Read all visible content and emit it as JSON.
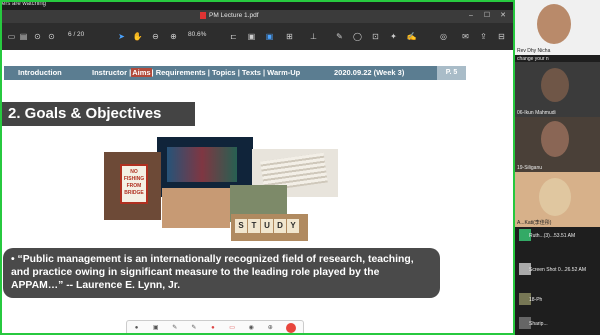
{
  "banner": {
    "text": "ers are watching"
  },
  "window": {
    "title": "PM Lecture 1.pdf"
  },
  "toolbar": {
    "page": "6",
    "page_total": "/ 20",
    "zoom": "80.6%"
  },
  "slide": {
    "nav": {
      "intro": "Introduction",
      "instructor": "Instructor | ",
      "aims": "Aims",
      "rest": " | Requirements | Topics | Texts | Warm-Up",
      "date": "2020.09.22  (Week 3)",
      "page_tag": "P. 5"
    },
    "heading": "2. Goals & Objectives",
    "nofish_sign": "NO FISHING FROM BRIDGE",
    "study_word": [
      "S",
      "T",
      "U",
      "D",
      "Y"
    ],
    "quote": "•  “Public management is an internationally recognized field of research, teaching, and practice owing in significant measure to the leading role played by the APPAM…” -- Laurence E. Lynn, Jr."
  },
  "zoom_controls": {
    "items": [
      {
        "label": "",
        "icon": "mic-icon"
      },
      {
        "label": "",
        "icon": "video-icon"
      },
      {
        "label": "",
        "icon": "security-icon"
      },
      {
        "label": "",
        "icon": "participants-icon"
      },
      {
        "label": "",
        "icon": "chat-icon"
      },
      {
        "label": "",
        "icon": "share-icon"
      },
      {
        "label": "",
        "icon": "record-icon"
      },
      {
        "label": "",
        "icon": "reactions-icon"
      }
    ]
  },
  "participants": {
    "tile1": {
      "name": "Rev Dhy Nicha",
      "overlay": "change your n"
    },
    "tile2": {
      "name": "06-Ikun Mahmudi"
    },
    "tile3": {
      "name": "19-Siliganu"
    },
    "tile4": {
      "name": "A...Kati(李佳彤)"
    },
    "small": [
      {
        "text": "Ruth...(3)...53.51 AM"
      },
      {
        "text": "Screen Shot 0...26.52 AM"
      },
      {
        "text": "18-Ph"
      },
      {
        "text": "Sharip..."
      }
    ]
  }
}
